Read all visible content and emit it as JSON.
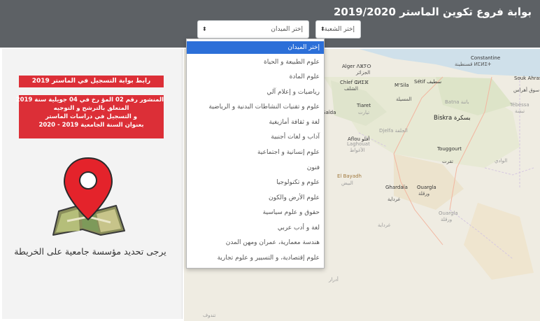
{
  "header": {
    "title": "بوابة فروع تكوين الماستر 2019/2020"
  },
  "filters": {
    "field_select": {
      "value": "إختر الميدان",
      "arrow": "⬍"
    },
    "prize_select": {
      "value": "إختر الشعبة",
      "arrow": "⬍"
    }
  },
  "sidebar": {
    "notice_link": "رابط بوابة التسجيل في الماستر 2019",
    "notice_lines": [
      "المنشور رقم 02 المؤ رخ في 04 جويلية سنة 2019",
      "المتعلق بالترشح و التوجيه",
      "و التسجيل في دراسات الماستر",
      "بعنوان السنة الجامعية 2019 - 2020"
    ],
    "caption": "يرجى تحديد مؤسسة جامعية على الخريطة"
  },
  "map": {
    "zoom_in": "+",
    "zoom_out": "−",
    "labels": {
      "alger": "Alger ⴷⵣⵢⵔ",
      "alger_ar": "الجزائر",
      "constantine": "Constantine",
      "constantine_ar": "قسنطينة ⵍⵎⵍⵉⵜ",
      "setif": "Sétif سطيف",
      "msila": "M'Sila",
      "msila_ar": "المسيلة",
      "chlef": "Chlef ⵛⵍⵉⴼ",
      "chlef_ar": "الشلف",
      "tiaret": "Tiaret",
      "tiaret_ar": "تيارت",
      "saida": "Saïda",
      "djelfa": "Djelfa الجلفة",
      "aflou": "Aflou أفلو",
      "laghouat": "Laghouat",
      "laghouat_ar": "الأغواط",
      "biskra": "Biskra بسكرة",
      "batna": "Batna باتنة",
      "souk_ahras": "Souk Ahras",
      "souk_ahras_ar": "سوق أهراس",
      "tebessa": "Tébessa",
      "tebessa_ar": "تبسة",
      "touggourt": "Touggourt",
      "touggourt_ar": "تقرت",
      "el_bayadh": "El Bayadh",
      "el_bayadh_ar": "البيض",
      "ghardaia": "Ghardaïa",
      "ghardaia_ar": "غرداية",
      "ouargla": "Ouargla",
      "ouargla_ar": "ورقلة",
      "ouargla2": "Ouargla",
      "ouargla2_ar": "ورقلة",
      "el_oued": "الوادي",
      "ghardaia_region": "غرداية",
      "adrar_faded": "أدرار",
      "bottom_faded": "تندوف"
    }
  },
  "dropdown": {
    "options": [
      "إختر الميدان",
      "علوم الطبيعة و الحياة",
      "علوم المادة",
      "رياضيات و إعلام آلي",
      "علوم و تقنيات النشاطات البدنية و الرياضية",
      "لغة و ثقافة أمازيغية",
      "آداب و لغات أجنبية",
      "علوم إنسانية و اجتماعية",
      "فنون",
      "علوم و تكنولوجيا",
      "علوم الأرض والكون",
      "حقوق و علوم سياسية",
      "لغة و أدب عربي",
      "هندسة معمارية، عمران ومهن المدن",
      "علوم إقتصادية، و التسيير و علوم تجارية"
    ],
    "selected_index": 0
  },
  "colors": {
    "header_bg": "#5d6165",
    "notice_red": "#dc2f37",
    "pin_red": "#e4232b",
    "selected_blue": "#2c6fd8",
    "map_bg": "#f1eee5"
  }
}
